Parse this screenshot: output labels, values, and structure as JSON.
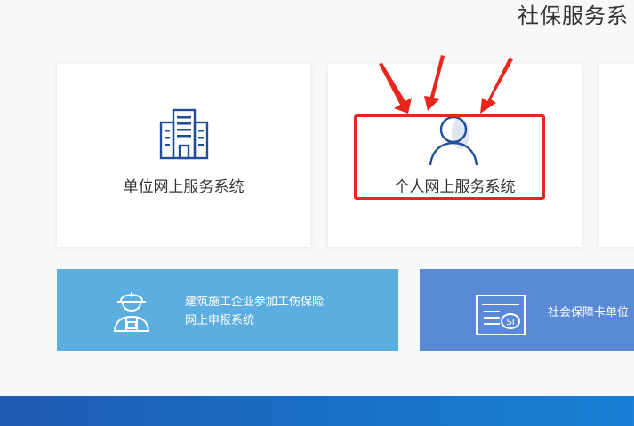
{
  "header": {
    "title": "社保服务系"
  },
  "cards": {
    "unit": {
      "label": "单位网上服务系统",
      "icon": "building-icon"
    },
    "person": {
      "label": "个人网上服务系统",
      "icon": "person-icon"
    }
  },
  "banners": {
    "construction": {
      "line1": "建筑施工企业参加工伤保险",
      "line2": "网上申报系统",
      "icon": "construction-worker-icon"
    },
    "social_card": {
      "label": "社会保障卡单位",
      "icon": "social-security-card-icon"
    }
  },
  "annotation": {
    "color": "#e8261c"
  },
  "colors": {
    "banner_light_blue": "#5baedf",
    "banner_blue": "#5a8ad6",
    "icon_blue": "#1f4f9a",
    "footer_blue": "#1a6ec8"
  }
}
